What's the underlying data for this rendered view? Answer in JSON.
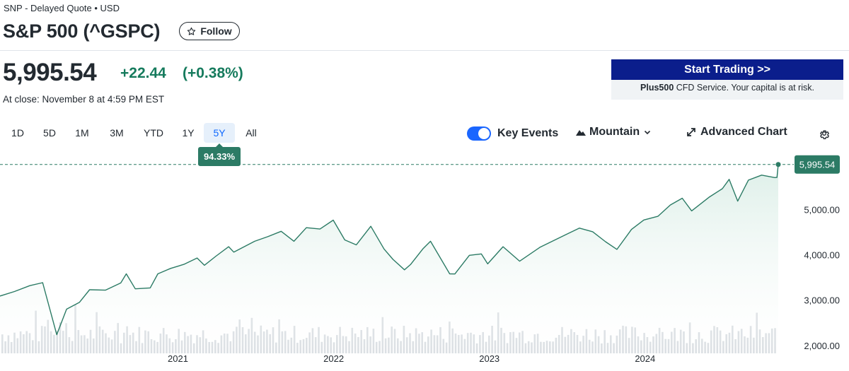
{
  "header": {
    "meta": "SNP - Delayed Quote • USD",
    "title": "S&P 500 (^GSPC)",
    "follow_label": "Follow"
  },
  "quote": {
    "price": "5,995.54",
    "change": "+22.44",
    "change_pct": "(+0.38%)",
    "close_note": "At close: November 8 at 4:59 PM EST"
  },
  "ad": {
    "button_label": "Start Trading >>",
    "brand": "Plus500",
    "disclaimer": " CFD Service. Your capital is at risk."
  },
  "range_tabs": [
    {
      "label": "1D",
      "active": false
    },
    {
      "label": "5D",
      "active": false
    },
    {
      "label": "1M",
      "active": false
    },
    {
      "label": "3M",
      "active": false
    },
    {
      "label": "YTD",
      "active": false
    },
    {
      "label": "1Y",
      "active": false
    },
    {
      "label": "5Y",
      "active": true
    },
    {
      "label": "All",
      "active": false
    }
  ],
  "range_change_badge": "94.33%",
  "controls": {
    "key_events_label": "Key Events",
    "key_events_on": true,
    "chart_type_label": "Mountain",
    "advanced_chart_label": "Advanced Chart"
  },
  "icons": {
    "follow": "star-icon",
    "chart_type": "mountain-icon",
    "chart_type_menu": "chevron-down-icon",
    "advanced_chart": "expand-arrows-icon",
    "settings": "gear-icon"
  },
  "colors": {
    "positive": "#167b5d",
    "line": "#2c7b65",
    "fill": "#e7f3ef",
    "accent": "#0f69ff",
    "ad_button": "#0b1e8c"
  },
  "chart_data": {
    "type": "area",
    "x_tick_labels": [
      "2021",
      "2022",
      "2023",
      "2024"
    ],
    "y_tick_labels": [
      "2,000.00",
      "3,000.00",
      "4,000.00",
      "5,000.00"
    ],
    "ylim": [
      1950,
      6350
    ],
    "last_value_label": "5,995.54",
    "last_value": 5995.54,
    "grid": false,
    "series": [
      {
        "x": [
          "2019-11-11",
          "2019-12-15",
          "2020-01-20",
          "2020-02-19",
          "2020-03-23",
          "2020-04-15",
          "2020-05-15",
          "2020-06-08",
          "2020-07-15",
          "2020-08-20",
          "2020-09-02",
          "2020-09-23",
          "2020-10-28",
          "2020-11-15",
          "2020-12-15",
          "2021-01-15",
          "2021-02-15",
          "2021-03-04",
          "2021-03-31",
          "2021-04-30",
          "2021-05-12",
          "2021-06-30",
          "2021-07-30",
          "2021-08-31",
          "2021-09-30",
          "2021-10-29",
          "2021-11-30",
          "2021-12-31",
          "2022-01-27",
          "2022-02-23",
          "2022-03-29",
          "2022-04-29",
          "2022-05-20",
          "2022-06-16",
          "2022-06-30",
          "2022-07-29",
          "2022-08-16",
          "2022-09-30",
          "2022-10-12",
          "2022-11-15",
          "2022-12-13",
          "2022-12-28",
          "2023-02-02",
          "2023-03-13",
          "2023-04-30",
          "2023-06-30",
          "2023-07-31",
          "2023-08-31",
          "2023-09-30",
          "2023-10-27",
          "2023-11-30",
          "2023-12-29",
          "2024-01-31",
          "2024-02-29",
          "2024-03-28",
          "2024-04-19",
          "2024-05-31",
          "2024-06-30",
          "2024-07-16",
          "2024-08-05",
          "2024-08-30",
          "2024-09-30",
          "2024-10-31",
          "2024-11-05",
          "2024-11-08"
        ],
        "values": [
          3090,
          3190,
          3320,
          3385,
          2237,
          2800,
          2950,
          3230,
          3220,
          3380,
          3580,
          3250,
          3270,
          3580,
          3700,
          3790,
          3930,
          3770,
          3970,
          4180,
          4060,
          4300,
          4400,
          4520,
          4300,
          4600,
          4570,
          4766,
          4330,
          4220,
          4630,
          4130,
          3900,
          3670,
          3785,
          4130,
          4300,
          3580,
          3577,
          3990,
          4020,
          3800,
          4180,
          3860,
          4170,
          4450,
          4590,
          4510,
          4290,
          4120,
          4560,
          4770,
          4850,
          5100,
          5250,
          4970,
          5280,
          5460,
          5667,
          5186,
          5650,
          5760,
          5705,
          5710,
          5995.54
        ]
      }
    ]
  }
}
